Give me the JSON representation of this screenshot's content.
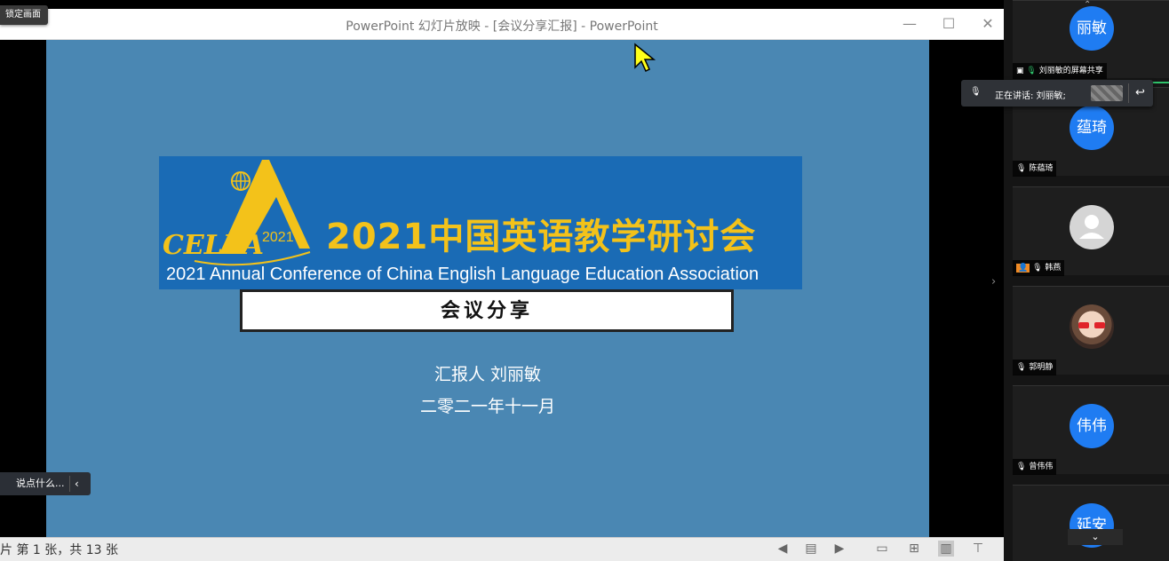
{
  "powerpoint": {
    "window_title": "PowerPoint 幻灯片放映 - [会议分享汇报] - PowerPoint",
    "minimize": "—",
    "maximize": "☐",
    "close": "✕"
  },
  "lock_screen_label": "锁定画面",
  "slide": {
    "banner_logo_text": "CELEA",
    "banner_logo_year": "2021",
    "banner_title_cn": "2021中国英语教学研讨会",
    "banner_title_en": "2021 Annual Conference of China English Language Education Association",
    "subtitle": "会议分享",
    "reporter": "汇报人 刘丽敏",
    "date": "二零二一年十一月"
  },
  "chat_input": {
    "placeholder": "说点什么..."
  },
  "statusbar": {
    "slide_count": "片 第 1 张，共 13 张"
  },
  "speaking": {
    "label": "正在讲话: 刘丽敏;"
  },
  "participants": [
    {
      "avatar_text": "丽敏",
      "tag": "刘丽敏的屏幕共享"
    },
    {
      "avatar_text": "蕴琦",
      "tag": "陈蕴琦"
    },
    {
      "avatar_text": "",
      "tag": "韩燕"
    },
    {
      "avatar_text": "",
      "tag": "郭明静"
    },
    {
      "avatar_text": "伟伟",
      "tag": "曾伟伟"
    },
    {
      "avatar_text": "延安",
      "tag": ""
    }
  ],
  "colors": {
    "slide_bg": "#4a87b3",
    "banner_bg": "#1a6bb5",
    "banner_gold": "#f3c21a",
    "avatar_blue": "#1f7cf2"
  }
}
